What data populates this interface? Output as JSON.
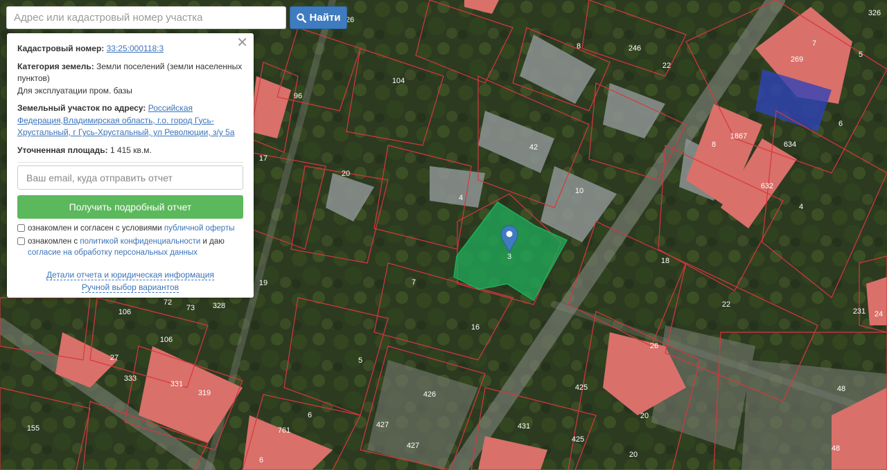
{
  "search": {
    "placeholder": "Адрес или кадастровый номер участка",
    "button_label": "Найти",
    "button_icon": "search-icon"
  },
  "panel": {
    "cadastral_label": "Кадастровый номер:",
    "cadastral_value": "33:25:000118:3",
    "category_label": "Категория земель:",
    "category_value": "Земли поселений (земли населенных пунктов)",
    "usage": "Для эксплуатации пром. базы",
    "address_label": "Земельный участок по адресу:",
    "address_value": "Российская Федерация,Владимирская область, г.о. город Гусь-Хрустальный, г Гусь-Хрустальный, ул Революции, з/у 5а",
    "area_label": "Уточненная площадь:",
    "area_value": "1 415 кв.м.",
    "email_placeholder": "Ваш email, куда отправить отчет",
    "get_report_label": "Получить подробный отчет",
    "consent1_prefix": "ознакомлен и согласен с условиями",
    "consent1_link": "публичной оферты",
    "consent2_prefix": "ознакомлен с",
    "consent2_link": "политикой конфиденциальности",
    "consent2_mid": "и даю",
    "consent2_link2": "согласие на обработку персональных данных",
    "details_link": "Детали отчета и юридическая информация",
    "manual_link": "Ручной выбор вариантов",
    "close_icon": "close-icon"
  },
  "map": {
    "marker_label": "3",
    "parcel_labels": [
      "26",
      "8",
      "22",
      "104",
      "96",
      "42",
      "10",
      "4",
      "20",
      "17",
      "7",
      "18",
      "22",
      "19",
      "106",
      "72",
      "73",
      "328",
      "106",
      "27",
      "331",
      "319",
      "333",
      "16",
      "5",
      "426",
      "427",
      "427",
      "6",
      "761",
      "6",
      "155",
      "431",
      "425",
      "425",
      "20",
      "20",
      "26",
      "48",
      "48",
      "231",
      "24",
      "1867",
      "634",
      "632",
      "4",
      "6",
      "8",
      "269",
      "7",
      "5",
      "246",
      "326"
    ],
    "colors": {
      "parcel_border": "#d9363e",
      "selected_fill": "#1fae5b",
      "roof": "#d9706a",
      "marker": "#3f7bbf"
    }
  }
}
